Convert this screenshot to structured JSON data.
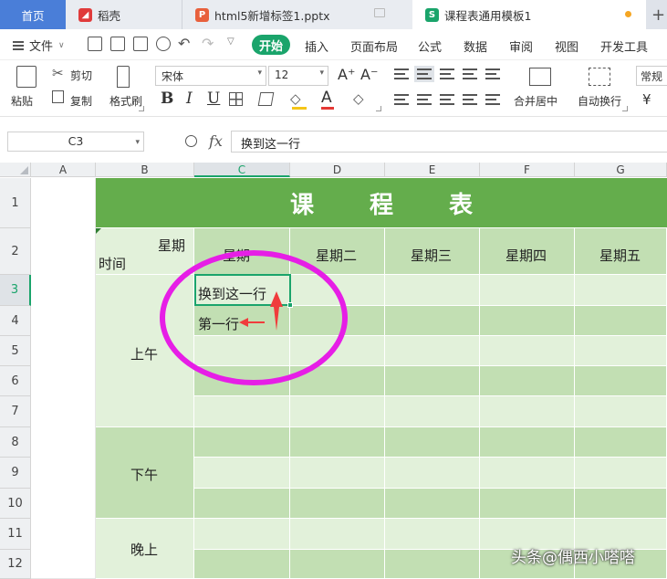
{
  "tabs": [
    {
      "label": "首页",
      "active": false
    },
    {
      "label": "稻壳",
      "icon": "daoke-icon",
      "color": "#e03b3b"
    },
    {
      "label": "html5新增标签1.pptx",
      "icon": "ppt-icon",
      "color": "#e8603c"
    },
    {
      "label": "课程表通用模板1",
      "icon": "sheet-icon",
      "color": "#1aa46b",
      "active": true
    }
  ],
  "menu": {
    "file": "文件",
    "start": "开始",
    "items": [
      "插入",
      "页面布局",
      "公式",
      "数据",
      "审阅",
      "视图",
      "开发工具"
    ]
  },
  "ribbon": {
    "paste": "粘贴",
    "cut": "剪切",
    "copy": "复制",
    "format_painter": "格式刷",
    "font_name": "宋体",
    "font_size": "12",
    "merge_center": "合并居中",
    "wrap_text": "自动换行",
    "number_format": "常规",
    "currency": "¥"
  },
  "formula_bar": {
    "name_box": "C3",
    "fx": "fx",
    "content": "换到这一行"
  },
  "columns": [
    "A",
    "B",
    "C",
    "D",
    "E",
    "F",
    "G"
  ],
  "rows": [
    "1",
    "2",
    "3",
    "4",
    "5",
    "6",
    "7",
    "8",
    "9",
    "10",
    "11",
    "12"
  ],
  "active_cell": {
    "column": "C",
    "row": "3"
  },
  "timetable": {
    "title": "课 程 表",
    "corner_top": "星期",
    "corner_bottom": "时间",
    "weekdays": [
      "星期",
      "星期二",
      "星期三",
      "星期四",
      "星期五"
    ],
    "periods": [
      "上午",
      "下午",
      "晚上"
    ],
    "cell_c3": "换到这一行",
    "cell_c4": "第一行"
  },
  "colors": {
    "title_band": "#64ad4c",
    "dark_row": "#c2dfb3",
    "light_row": "#e2f1da",
    "accent": "#1aa46b",
    "annotation": "#e61ee6",
    "arrow": "#f03c3c"
  },
  "watermark": "头条@偶西小嗒嗒"
}
